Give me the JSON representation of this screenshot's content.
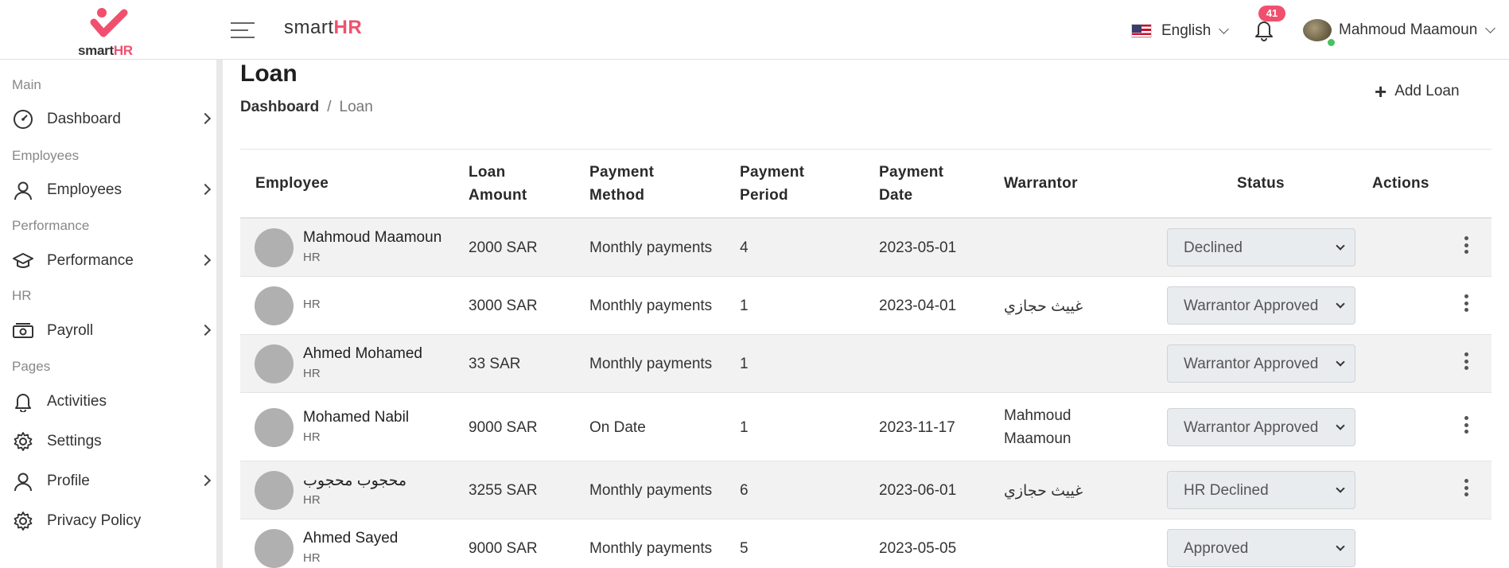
{
  "header": {
    "logo_text": "smart",
    "logo_text_hr": "HR",
    "brand_text": "smart",
    "brand_text_hr": "HR",
    "language": "English",
    "notifications_count": "41",
    "user_name": "Mahmoud Maamoun"
  },
  "sidebar": {
    "sections": [
      {
        "title": "Main"
      },
      {
        "title": "Employees"
      },
      {
        "title": "Performance"
      },
      {
        "title": "HR"
      },
      {
        "title": "Pages"
      }
    ],
    "items": [
      {
        "label": "Dashboard",
        "icon": "dashboard-icon"
      },
      {
        "label": "Employees",
        "icon": "user-icon"
      },
      {
        "label": "Performance",
        "icon": "graduation-cap-icon"
      },
      {
        "label": "Payroll",
        "icon": "money-icon"
      },
      {
        "label": "Activities",
        "icon": "bell-icon"
      },
      {
        "label": "Settings",
        "icon": "gear-icon"
      },
      {
        "label": "Profile",
        "icon": "user-icon"
      },
      {
        "label": "Privacy Policy",
        "icon": "gear-icon"
      }
    ]
  },
  "page": {
    "title": "Loan",
    "breadcrumb": {
      "home": "Dashboard",
      "separator": "/",
      "current": "Loan"
    },
    "add_button": "Add Loan"
  },
  "table": {
    "headers": {
      "employee": "Employee",
      "amount_1": "Loan",
      "amount_2": "Amount",
      "method_1": "Payment",
      "method_2": "Method",
      "period_1": "Payment",
      "period_2": "Period",
      "date_1": "Payment",
      "date_2": "Date",
      "warrantor": "Warrantor",
      "status": "Status",
      "actions": "Actions"
    },
    "rows": [
      {
        "name": "Mahmoud Maamoun",
        "role": "HR",
        "amount": "2000 SAR",
        "method": "Monthly payments",
        "period": "4",
        "date": "2023-05-01",
        "warrantor": "",
        "status": "Declined"
      },
      {
        "name": "",
        "role": "HR",
        "amount": "3000 SAR",
        "method": "Monthly payments",
        "period": "1",
        "date": "2023-04-01",
        "warrantor": "غييث حجازي",
        "status": "Warrantor Approved"
      },
      {
        "name": "Ahmed Mohamed",
        "role": "HR",
        "amount": "33 SAR",
        "method": "Monthly payments",
        "period": "1",
        "date": "",
        "warrantor": "",
        "status": "Warrantor Approved"
      },
      {
        "name": "Mohamed Nabil",
        "role": "HR",
        "amount": "9000 SAR",
        "method": "On Date",
        "period": "1",
        "date": "2023-11-17",
        "warrantor": "Mahmoud Maamoun",
        "status": "Warrantor Approved"
      },
      {
        "name": "محجوب محجوب",
        "role": "HR",
        "amount": "3255 SAR",
        "method": "Monthly payments",
        "period": "6",
        "date": "2023-06-01",
        "warrantor": "غييث حجازي",
        "status": "HR Declined"
      },
      {
        "name": "Ahmed Sayed",
        "role": "HR",
        "amount": "9000 SAR",
        "method": "Monthly payments",
        "period": "5",
        "date": "2023-05-05",
        "warrantor": "",
        "status": "Approved"
      }
    ]
  }
}
